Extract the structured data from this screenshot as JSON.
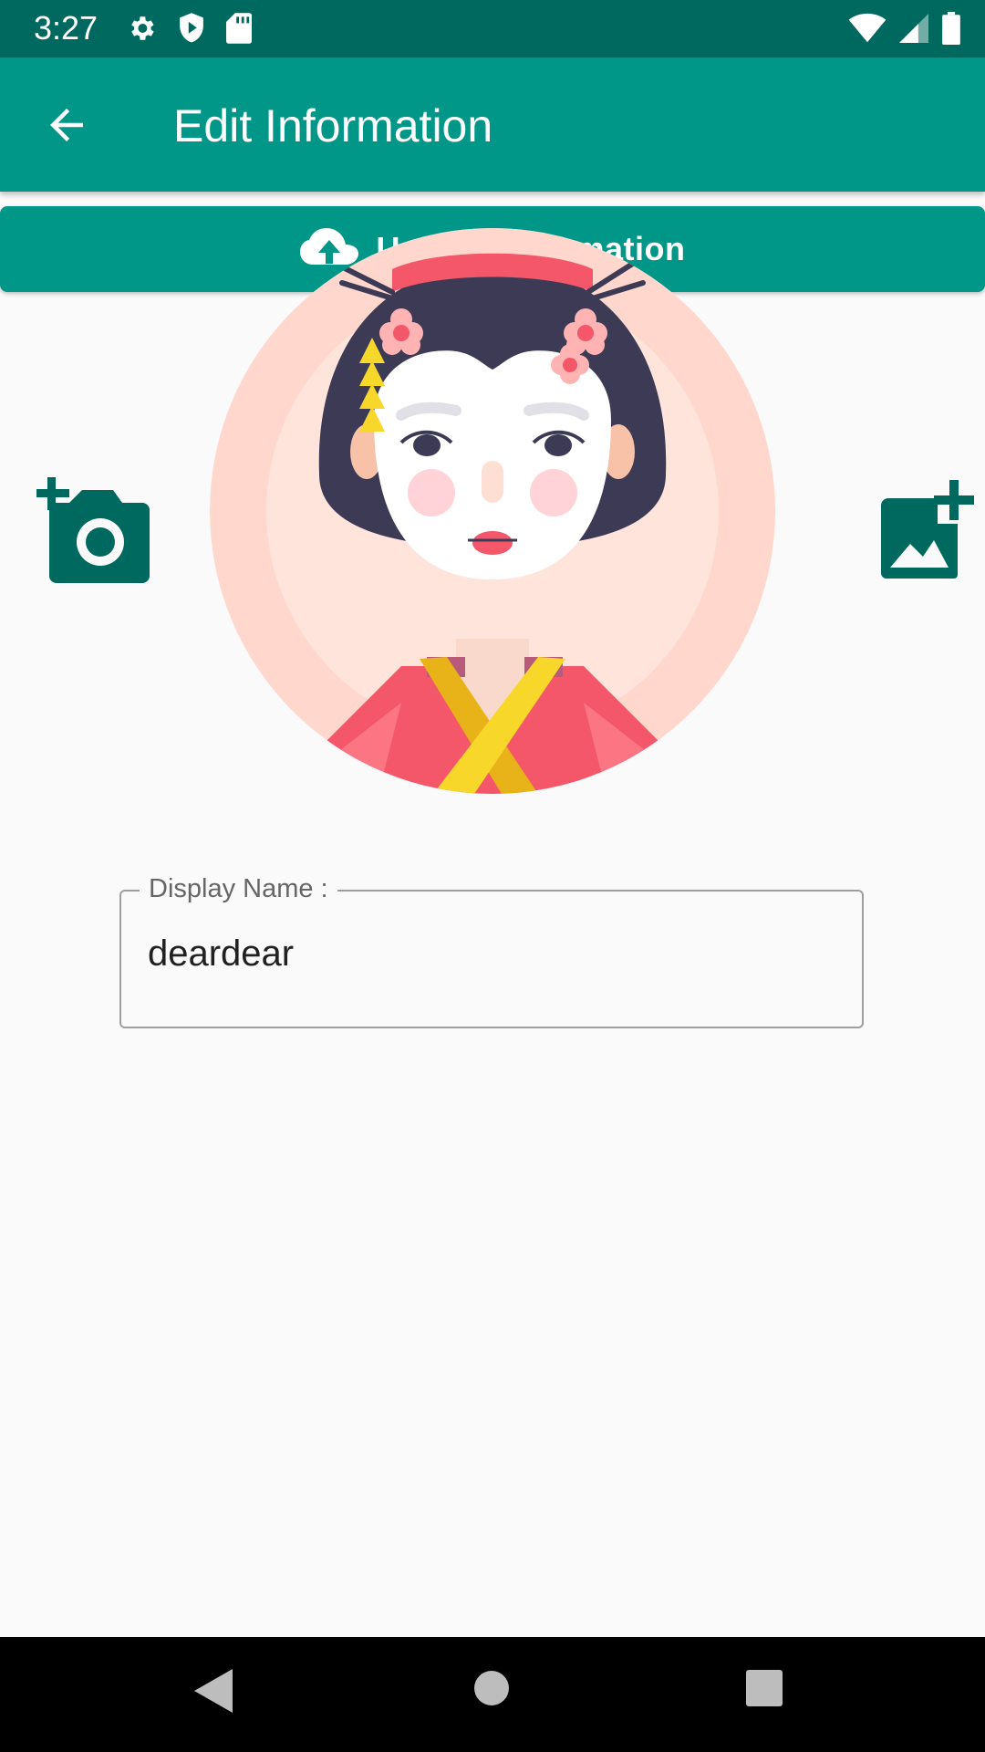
{
  "status_bar": {
    "time": "3:27",
    "left_icons": [
      "settings-icon",
      "shield-icon",
      "sd-card-icon"
    ],
    "right_icons": [
      "wifi-icon",
      "cell-signal-icon",
      "battery-icon"
    ]
  },
  "app_bar": {
    "title": "Edit Information",
    "back_icon": "arrow-back-icon"
  },
  "update_button": {
    "label": "Update Information",
    "icon": "cloud-upload-icon"
  },
  "avatar": {
    "icon": "geisha-avatar"
  },
  "actions": {
    "camera_icon": "add-camera-icon",
    "gallery_icon": "add-photo-icon"
  },
  "display_name": {
    "label": "Display Name :",
    "value": "deardear"
  },
  "colors": {
    "primary": "#009688",
    "primary_dark": "#00695f",
    "icon_dark": "#00695f"
  },
  "nav_bar": {
    "icons": [
      "nav-back-icon",
      "nav-home-icon",
      "nav-recents-icon"
    ]
  }
}
